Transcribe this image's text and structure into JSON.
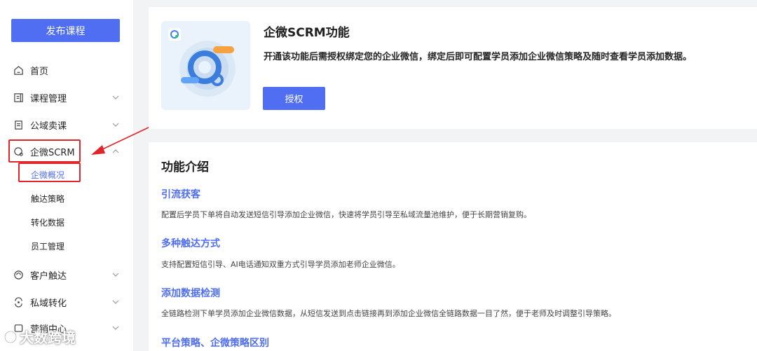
{
  "sidebar": {
    "publish_label": "发布课程",
    "items": [
      {
        "label": "首页",
        "icon": "home-icon"
      },
      {
        "label": "课程管理",
        "icon": "course-icon"
      },
      {
        "label": "公域卖课",
        "icon": "clipboard-icon"
      },
      {
        "label": "企微SCRM",
        "icon": "scrm-icon"
      },
      {
        "label": "客户触达",
        "icon": "reach-icon"
      },
      {
        "label": "私域转化",
        "icon": "convert-icon"
      },
      {
        "label": "营销中心",
        "icon": "marketing-icon"
      }
    ],
    "sub_items": [
      {
        "label": "企微概况"
      },
      {
        "label": "触达策略"
      },
      {
        "label": "转化数据"
      },
      {
        "label": "员工管理"
      }
    ]
  },
  "feature": {
    "title": "企微SCRM功能",
    "description": "开通该功能后需授权绑定您的企业微信，绑定后即可配置学员添加企业微信策略及随时查看学员添加数据。",
    "auth_label": "授权"
  },
  "intro": {
    "title": "功能介绍",
    "sections": [
      {
        "title": "引流获客",
        "desc": "配置后学员下单将自动发送短信引导添加企业微信，快速将学员引导至私域流量池维护，便于长期营销复购。"
      },
      {
        "title": "多种触达方式",
        "desc": "支持配置短信引导、AI电话通知双重方式引导学员添加老师企业微信。"
      },
      {
        "title": "添加数据检测",
        "desc": "全链路检测下单学员添加企业微信数据，从短信发送到点击链接再到添加企业微信全链路数据一目了然，便于老师及时调整引导策略。"
      },
      {
        "title": "平台策略、企微策略区别",
        "desc": ""
      }
    ]
  },
  "watermark": {
    "text": "大数跨境"
  },
  "colors": {
    "accent": "#4f6ef2",
    "highlight": "#e0262a"
  }
}
